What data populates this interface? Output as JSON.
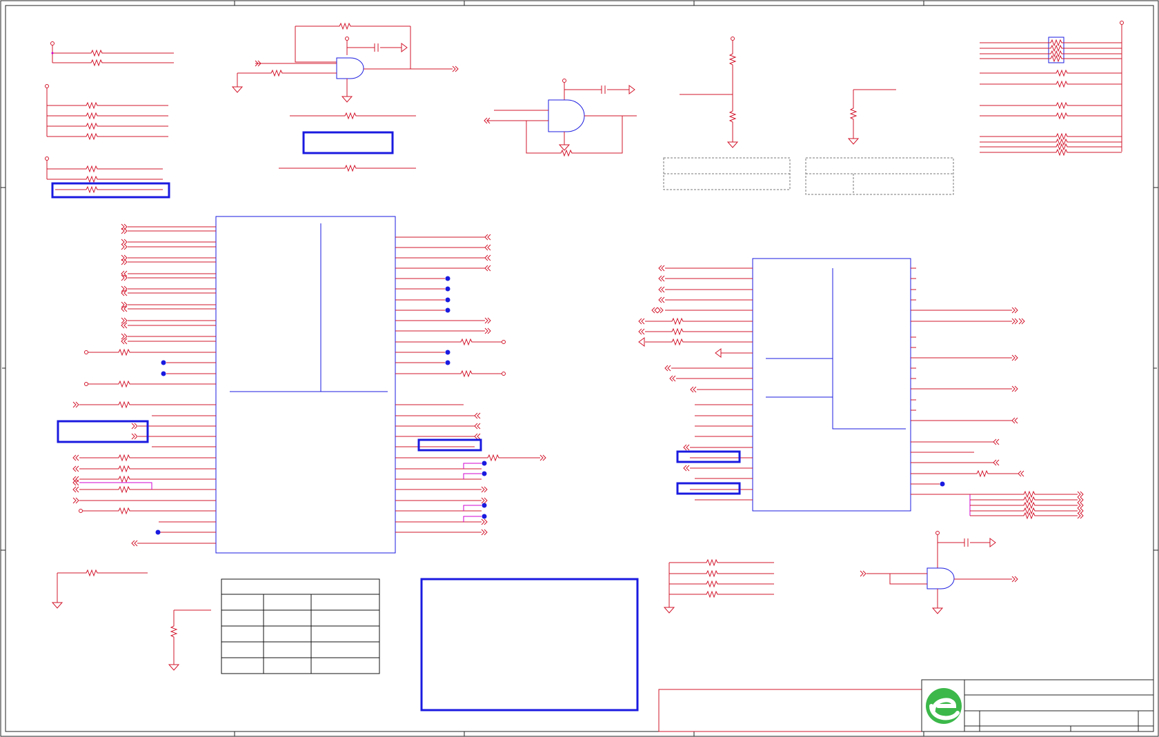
{
  "colors": {
    "wire": "#d2142a",
    "junction": "#d000d0",
    "component": "#1a1ae0",
    "frame": "#222222",
    "logo_green": "#3cb84a"
  },
  "icons": [
    "resistor-icon",
    "capacitor-icon",
    "ground-icon",
    "and-gate-icon",
    "off-page-connector-icon",
    "logo-icon"
  ]
}
